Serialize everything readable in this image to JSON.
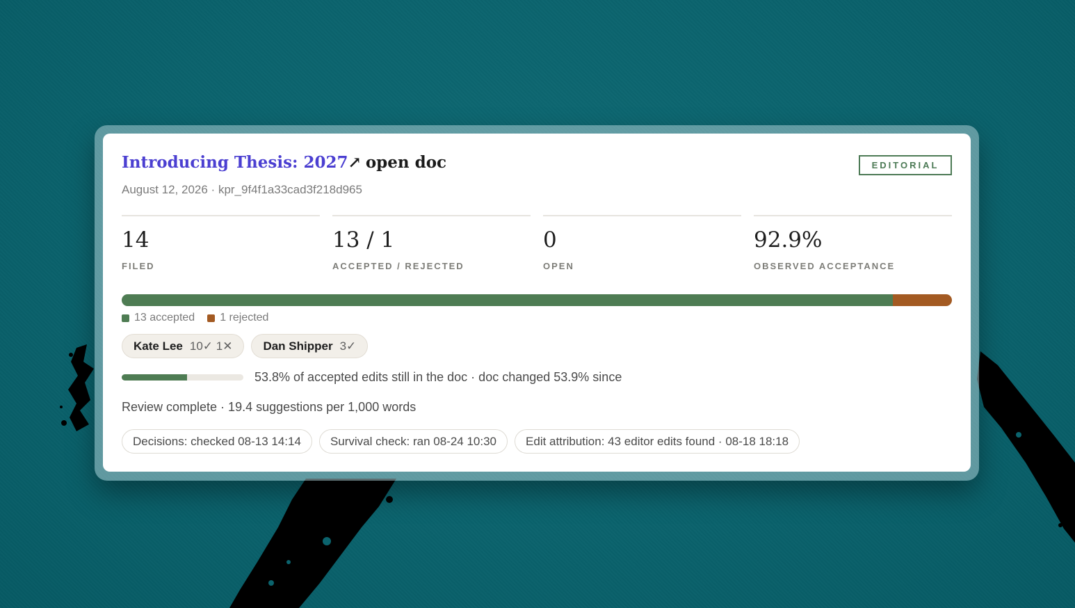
{
  "doc": {
    "title": "Introducing Thesis: 2027",
    "title_arrow": "↗",
    "open_doc_label": "open doc",
    "date": "August 12, 2026",
    "separator": " · ",
    "id": "kpr_9f4f1a33cad3f218d965",
    "badge": "EDITORIAL"
  },
  "stats": [
    {
      "value": "14",
      "label": "FILED"
    },
    {
      "value": "13 / 1",
      "label": "ACCEPTED / REJECTED"
    },
    {
      "value": "0",
      "label": "OPEN"
    },
    {
      "value": "92.9%",
      "label": "OBSERVED ACCEPTANCE"
    }
  ],
  "decision_bar": {
    "accepted_count": 13,
    "rejected_count": 1,
    "accepted_color": "#4e7c53",
    "rejected_color": "#a35a22"
  },
  "legend": {
    "accepted": "13 accepted",
    "rejected": "1 rejected"
  },
  "editors": [
    {
      "name": "Kate Lee",
      "stats": "10✓ 1✕"
    },
    {
      "name": "Dan Shipper",
      "stats": "3✓"
    }
  ],
  "survival": {
    "fraction": 0.538,
    "text": "53.8% of accepted edits still in the doc · doc changed 53.9% since"
  },
  "review_text": "Review complete · 19.4 suggestions per 1,000 words",
  "checks": [
    {
      "label": "Decisions: checked 08-13 14:14"
    },
    {
      "label": "Survival check: ran 08-24 10:30"
    },
    {
      "label": "Edit attribution: 43 editor edits found · 08-18 18:18"
    }
  ],
  "colors": {
    "background": "#0b636d",
    "title_link": "#4b3fd1",
    "badge": "#4c7a55"
  }
}
